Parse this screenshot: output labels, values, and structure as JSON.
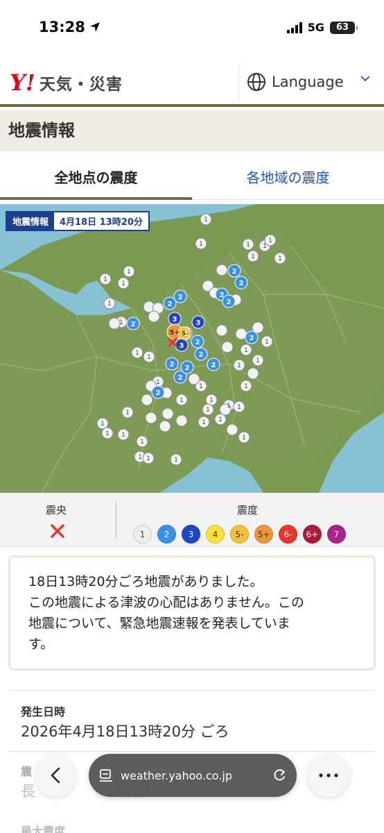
{
  "status_bar": {
    "time": "13:28",
    "network": "5G",
    "battery": "63"
  },
  "header": {
    "logo_mark": "Y!",
    "logo_text": "天気・災害",
    "language_label": "Language"
  },
  "section_title": "地震情報",
  "tabs": [
    {
      "label": "全地点の震度",
      "active": true
    },
    {
      "label": "各地域の震度",
      "active": false
    }
  ],
  "map": {
    "label_title": "地震情報",
    "label_time": "4月18日 13時20分",
    "markers": [
      {
        "label": "1",
        "value": 1
      },
      {
        "label": "2",
        "value": 2
      },
      {
        "label": "3",
        "value": 3
      },
      {
        "label": "5+",
        "value": "5+"
      },
      {
        "label": "5-",
        "value": "5-"
      }
    ]
  },
  "legend": {
    "epicenter_label": "震央",
    "intensity_label": "震度",
    "items": [
      {
        "label": "1",
        "color": "#eeeeee",
        "text_color": "#444"
      },
      {
        "label": "2",
        "color": "#3a8fe8",
        "text_color": "#fff"
      },
      {
        "label": "3",
        "color": "#1f45c9",
        "text_color": "#fff"
      },
      {
        "label": "4",
        "color": "#f5e23c",
        "text_color": "#333"
      },
      {
        "label": "5-",
        "color": "#f3c13a",
        "text_color": "#333"
      },
      {
        "label": "5+",
        "color": "#f0963a",
        "text_color": "#333"
      },
      {
        "label": "6-",
        "color": "#e8362a",
        "text_color": "#fff"
      },
      {
        "label": "6+",
        "color": "#b01a3a",
        "text_color": "#fff"
      },
      {
        "label": "7",
        "color": "#a8248c",
        "text_color": "#fff"
      }
    ]
  },
  "notice": {
    "line1": "18日13時20分ごろ地震がありました。",
    "line2": "この地震による津波の心配はありません。この",
    "line3": "地震について、緊急地震速報を発表していま",
    "line4": "す。"
  },
  "details": {
    "occurrence_label": "発生日時",
    "occurrence_value": "2026年4月18日13時20分 ごろ",
    "epicenter_label_partial": "震",
    "epicenter_value_partial": "長",
    "epicenter_value_tail": "北部",
    "max_intensity_label_partial": "最大震度"
  },
  "browser": {
    "url": "weather.yahoo.co.jp"
  }
}
